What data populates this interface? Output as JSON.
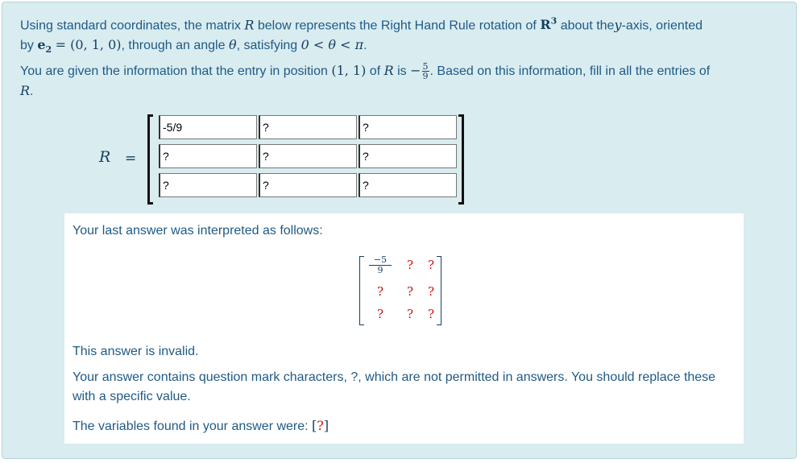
{
  "question": {
    "line1_a": "Using standard coordinates, the matrix",
    "R": "R",
    "line1_b": "below represents the Right Hand Rule rotation of",
    "space": "R",
    "space_exp": "3",
    "line1_c": "about the",
    "axis": "y",
    "line1_d": "-axis, oriented",
    "line2_a": "by",
    "e2": "e",
    "e2_sub": "2",
    "vector": "= (0, 1, 0)",
    "line2_b": ", through an angle",
    "theta": "θ",
    "line2_c": ", satisfying",
    "ineq": "0 < θ < π",
    "end": ".",
    "given_a": "You are given the information that the entry in position",
    "pos": "(1, 1)",
    "given_b": "of",
    "given_c": "is",
    "minus": "−",
    "frac_num": "5",
    "frac_den": "9",
    "given_d": ". Based on this information, fill in all the entries of",
    "given_e": "R",
    "given_f": "."
  },
  "matrix_input": {
    "label": "R",
    "equals": "=",
    "cells": [
      [
        "-5/9",
        "?",
        "?"
      ],
      [
        "?",
        "?",
        "?"
      ],
      [
        "?",
        "?",
        "?"
      ]
    ]
  },
  "feedback": {
    "interpreted": "Your last answer was interpreted as follows:",
    "display": {
      "frac_num": "−5",
      "frac_den": "9",
      "cells": [
        [
          "",
          "?",
          "?"
        ],
        [
          "?",
          "?",
          "?"
        ],
        [
          "?",
          "?",
          "?"
        ]
      ]
    },
    "invalid": "This answer is invalid.",
    "explanation": "Your answer contains question mark characters, ?, which are not permitted in answers. You should replace these with a specific value.",
    "vars_label": "The variables found in your answer were:",
    "vars_open": "[",
    "vars_value": "?",
    "vars_close": "]"
  },
  "colors": {
    "panel_bg": "#d9ecf0",
    "text": "#1f5a86",
    "error_red": "#d01010"
  }
}
